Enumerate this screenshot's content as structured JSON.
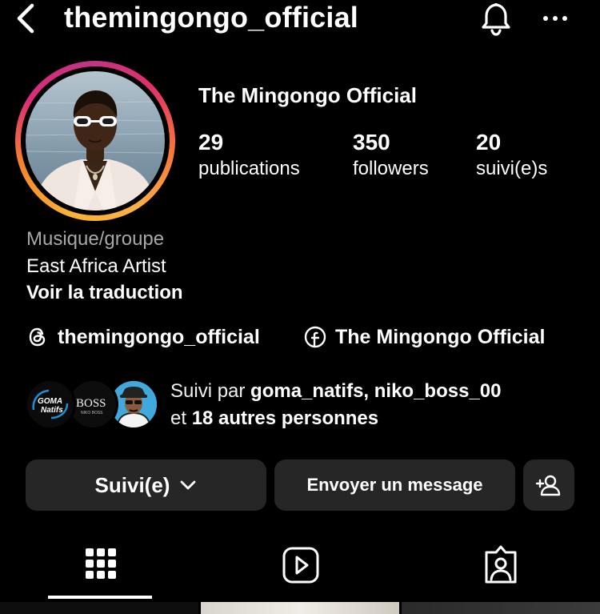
{
  "header": {
    "username": "themingongo_official",
    "back_icon": "chevron-left-icon",
    "bell_icon": "bell-icon",
    "more_icon": "ellipsis-icon"
  },
  "profile": {
    "display_name": "The Mingongo Official",
    "stats": [
      {
        "value": "29",
        "label": "publications"
      },
      {
        "value": "350",
        "label": "followers"
      },
      {
        "value": "20",
        "label": "suivi(e)s"
      }
    ]
  },
  "bio": {
    "category": "Musique/groupe",
    "text": "East Africa Artist",
    "translate_label": "Voir la traduction"
  },
  "links": {
    "threads_handle": "themingongo_official",
    "facebook_name": "The Mingongo Official"
  },
  "followed_by": {
    "prefix": "Suivi par ",
    "names": "goma_natifs, niko_boss_00",
    "and": "et ",
    "others": "18 autres personnes",
    "avatar_1_line1": "GOMA",
    "avatar_1_line2": "Natifs",
    "avatar_2_text": "BOSS",
    "avatar_2_sub": "NIKO BOSS"
  },
  "buttons": {
    "following_label": "Suivi(e)",
    "message_label": "Envoyer un message",
    "add_person_icon": "add-person-icon"
  },
  "tabs": [
    {
      "icon": "grid-icon",
      "active": true
    },
    {
      "icon": "reels-icon",
      "active": false
    },
    {
      "icon": "tagged-icon",
      "active": false
    }
  ],
  "colors": {
    "background": "#000000",
    "button": "#262626",
    "muted_text": "#a8a8a8",
    "ring_start": "#f58529",
    "ring_mid": "#dd2a7b",
    "ring_end": "#fcaf45"
  }
}
